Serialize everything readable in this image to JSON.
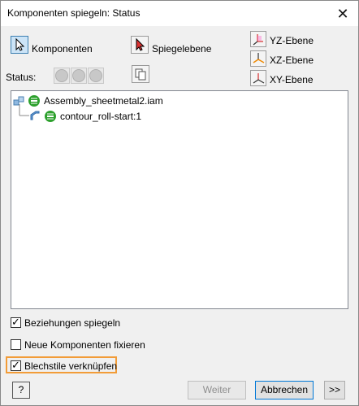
{
  "window": {
    "title": "Komponenten spiegeln: Status",
    "close_glyph": "✕"
  },
  "selection": {
    "komponenten_label": "Komponenten",
    "spiegelebene_label": "Spiegelebene"
  },
  "planes": {
    "yz": "YZ-Ebene",
    "xz": "XZ-Ebene",
    "xy": "XY-Ebene"
  },
  "status": {
    "label": "Status:"
  },
  "tree": {
    "root_label": "Assembly_sheetmetal2.iam",
    "child_label": "contour_roll-start:1"
  },
  "options": {
    "beziehungen_label": "Beziehungen spiegeln",
    "beziehungen_checked": true,
    "fixieren_label": "Neue Komponenten fixieren",
    "fixieren_checked": false,
    "blechstile_label": "Blechstile verknüpfen",
    "blechstile_checked": true
  },
  "footer": {
    "help_label": "?",
    "weiter_label": "Weiter",
    "abbrechen_label": "Abbrechen",
    "more_label": ">>"
  },
  "colors": {
    "accent": "#0078d7",
    "highlight": "#f29c38",
    "status_green": "#2ca02c"
  }
}
